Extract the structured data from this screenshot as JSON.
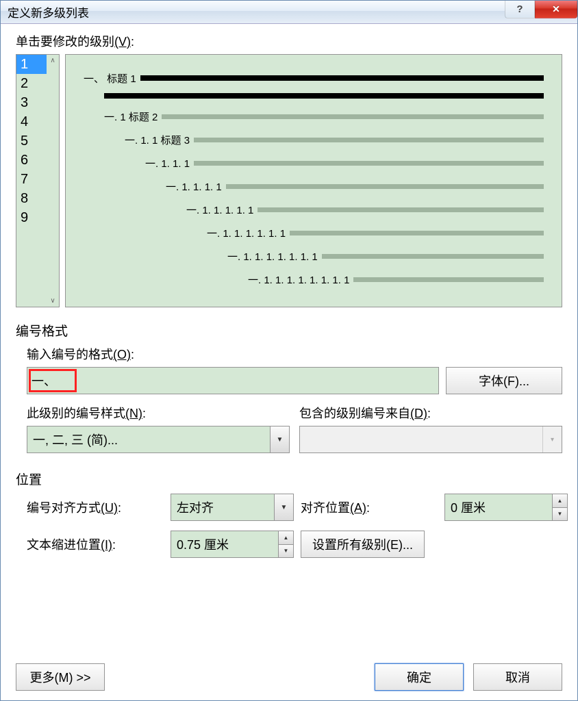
{
  "title": "定义新多级列表",
  "help_symbol": "?",
  "close_symbol": "✕",
  "section_click_level": "单击要修改的级别",
  "section_click_level_accel": "(V)",
  "levels": [
    "1",
    "2",
    "3",
    "4",
    "5",
    "6",
    "7",
    "8",
    "9"
  ],
  "selected_level_index": 0,
  "preview": {
    "lines": [
      {
        "indent": 0,
        "label": "一、 标题 1",
        "black": true
      },
      {
        "indent": 30,
        "label": "",
        "black": true,
        "fullbar": true
      },
      {
        "indent": 30,
        "label": "一. 1 标题 2"
      },
      {
        "indent": 60,
        "label": "一. 1. 1 标题 3"
      },
      {
        "indent": 90,
        "label": "一. 1. 1. 1"
      },
      {
        "indent": 120,
        "label": "一. 1. 1. 1. 1"
      },
      {
        "indent": 150,
        "label": "一. 1. 1. 1. 1. 1"
      },
      {
        "indent": 180,
        "label": "一. 1. 1. 1. 1. 1. 1"
      },
      {
        "indent": 210,
        "label": "一. 1. 1. 1. 1. 1. 1. 1"
      },
      {
        "indent": 240,
        "label": "一. 1. 1. 1. 1. 1. 1. 1. 1"
      }
    ]
  },
  "group_number_format": "编号格式",
  "label_enter_format": "输入编号的格式",
  "label_enter_format_accel": "(O)",
  "number_format_value": "一、",
  "font_button": "字体(F)...",
  "label_number_style": "此级别的编号样式",
  "label_number_style_accel": "(N)",
  "number_style_value": "一, 二, 三 (简)...",
  "label_include_from": "包含的级别编号来自",
  "label_include_from_accel": "(D)",
  "include_from_value": "",
  "group_position": "位置",
  "label_alignment": "编号对齐方式",
  "label_alignment_accel": "(U)",
  "alignment_value": "左对齐",
  "label_aligned_at": "对齐位置",
  "label_aligned_at_accel": "(A)",
  "aligned_at_value": "0 厘米",
  "label_text_indent": "文本缩进位置",
  "label_text_indent_accel": "(I)",
  "text_indent_value": "0.75 厘米",
  "set_all_levels_button": "设置所有级别(E)...",
  "more_button": "更多(M) >>",
  "ok_button": "确定",
  "cancel_button": "取消"
}
